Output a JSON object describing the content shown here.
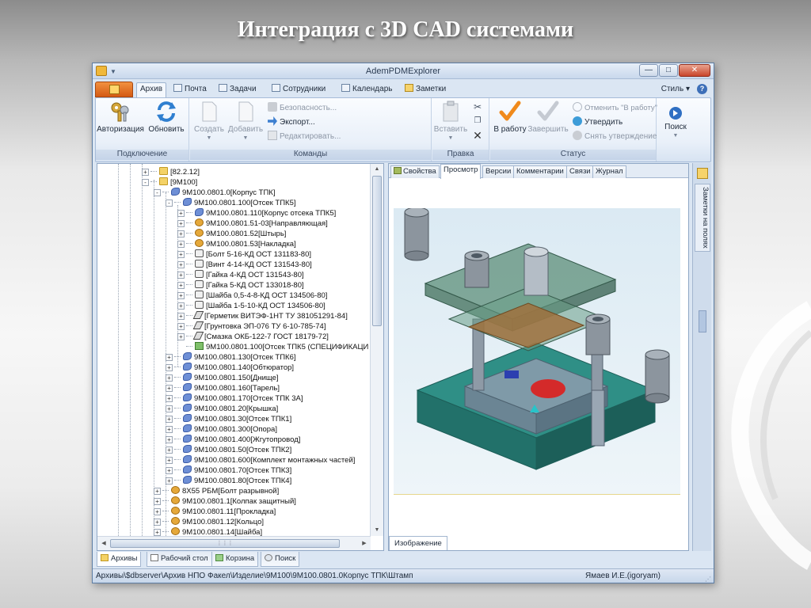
{
  "slide": {
    "title": "Интеграция с 3D CAD системами"
  },
  "window": {
    "title": "AdemPDMExplorer"
  },
  "ribbon_tabs": [
    {
      "label": "Архив"
    },
    {
      "label": "Почта"
    },
    {
      "label": "Задачи"
    },
    {
      "label": "Сотрудники"
    },
    {
      "label": "Календарь"
    },
    {
      "label": "Заметки"
    }
  ],
  "style_menu": "Стиль",
  "help": "?",
  "groups": {
    "connect": {
      "label": "Подключение",
      "auth": "Авторизация",
      "refresh": "Обновить"
    },
    "commands": {
      "label": "Команды",
      "create": "Создать",
      "add": "Добавить",
      "security": "Безопасность...",
      "export": "Экспорт...",
      "edit": "Редактировать..."
    },
    "edit": {
      "label": "Правка",
      "paste": "Вставить"
    },
    "status": {
      "label": "Статус",
      "to_work": "В работу",
      "finish": "Завершить",
      "cancel_work": "Отменить \"В работу\"",
      "approve": "Утвердить",
      "unapprove": "Снять утверждение"
    },
    "search": {
      "label": "Поиск"
    }
  },
  "tree": [
    {
      "text": "[82.2.12]",
      "icon": "folder",
      "exp": "+"
    },
    {
      "text": "[9M100]",
      "icon": "folder",
      "exp": "-"
    },
    {
      "text": "9M100.0801.0[Корпус ТПК]",
      "icon": "asm",
      "exp": "-"
    },
    {
      "text": "9M100.0801.100[Отсек ТПК5]",
      "icon": "asm",
      "exp": "-"
    },
    {
      "text": "9M100.0801.110[Корпус отсека ТПК5]",
      "icon": "asm",
      "exp": "+"
    },
    {
      "text": "9M100.0801.51-03[Направляющая]",
      "icon": "part",
      "exp": "+"
    },
    {
      "text": "9M100.0801.52[Штырь]",
      "icon": "part",
      "exp": "+"
    },
    {
      "text": "9M100.0801.53[Накладка]",
      "icon": "part",
      "exp": "+"
    },
    {
      "text": "[Болт 5-16-КД ОСТ 131183-80]",
      "icon": "std",
      "exp": "+"
    },
    {
      "text": "[Винт 4-14-КД ОСТ 131543-80]",
      "icon": "std",
      "exp": "+"
    },
    {
      "text": "[Гайка 4-КД ОСТ 131543-80]",
      "icon": "std",
      "exp": "+"
    },
    {
      "text": "[Гайка 5-КД ОСТ 133018-80]",
      "icon": "std",
      "exp": "+"
    },
    {
      "text": "[Шайба 0,5-4-8-КД ОСТ 134506-80]",
      "icon": "std",
      "exp": "+"
    },
    {
      "text": "[Шайба 1-5-10-КД ОСТ 134506-80]",
      "icon": "std",
      "exp": "+"
    },
    {
      "text": "[Герметик ВИТЭФ-1НТ ТУ 381051291-84]",
      "icon": "mat",
      "exp": "+"
    },
    {
      "text": "[Грунтовка ЭП-076 ТУ 6-10-785-74]",
      "icon": "mat",
      "exp": "+"
    },
    {
      "text": "[Смазка ОКБ-122-7 ГОСТ 18179-72]",
      "icon": "mat",
      "exp": "+"
    },
    {
      "text": "9M100.0801.100[Отсек ТПК5 (СПЕЦИФИКАЦИ",
      "icon": "spec",
      "exp": ""
    },
    {
      "text": "9M100.0801.130[Отсек ТПК6]",
      "icon": "asm",
      "exp": "+"
    },
    {
      "text": "9M100.0801.140[Обтюратор]",
      "icon": "asm",
      "exp": "+"
    },
    {
      "text": "9M100.0801.150[Днище]",
      "icon": "asm",
      "exp": "+"
    },
    {
      "text": "9M100.0801.160[Тарель]",
      "icon": "asm",
      "exp": "+"
    },
    {
      "text": "9M100.0801.170[Отсек ТПК 3А]",
      "icon": "asm",
      "exp": "+"
    },
    {
      "text": "9M100.0801.20[Крышка]",
      "icon": "asm",
      "exp": "+"
    },
    {
      "text": "9M100.0801.30[Отсек ТПК1]",
      "icon": "asm",
      "exp": "+"
    },
    {
      "text": "9M100.0801.300[Опора]",
      "icon": "asm",
      "exp": "+"
    },
    {
      "text": "9M100.0801.400[Жгутопровод]",
      "icon": "asm",
      "exp": "+"
    },
    {
      "text": "9M100.0801.50[Отсек ТПК2]",
      "icon": "asm",
      "exp": "+"
    },
    {
      "text": "9M100.0801.600[Комплект монтажных частей]",
      "icon": "asm",
      "exp": "+"
    },
    {
      "text": "9M100.0801.70[Отсек ТПК3]",
      "icon": "asm",
      "exp": "+"
    },
    {
      "text": "9M100.0801.80[Отсек ТПК4]",
      "icon": "asm",
      "exp": "+"
    },
    {
      "text": "8Х55 РБМ[Болт разрывной]",
      "icon": "part",
      "exp": "+"
    },
    {
      "text": "9M100.0801.1[Колпак защитный]",
      "icon": "part",
      "exp": "+"
    },
    {
      "text": "9M100.0801.11[Прокладка]",
      "icon": "part",
      "exp": "+"
    },
    {
      "text": "9M100.0801.12[Кольцо]",
      "icon": "part",
      "exp": "+"
    },
    {
      "text": "9M100.0801.14[Шайба]",
      "icon": "part",
      "exp": "+"
    }
  ],
  "panel_tabs": [
    {
      "label": "Свойства"
    },
    {
      "label": "Просмотр"
    },
    {
      "label": "Версии"
    },
    {
      "label": "Комментарии"
    },
    {
      "label": "Связи"
    },
    {
      "label": "Журнал"
    }
  ],
  "image_tab": "Изображение",
  "side_panel": "Заметки на полях",
  "bottom_tabs": [
    {
      "label": "Архивы"
    },
    {
      "label": "Рабочий стол"
    },
    {
      "label": "Корзина"
    },
    {
      "label": "Поиск"
    }
  ],
  "status": {
    "path": "Архивы\\$dbserver\\Архив НПО Факел\\Изделие\\9M100\\9M100.0801.0Корпус ТПК\\Штамп",
    "user": "Ямаев И.Е.(igoryam)"
  }
}
